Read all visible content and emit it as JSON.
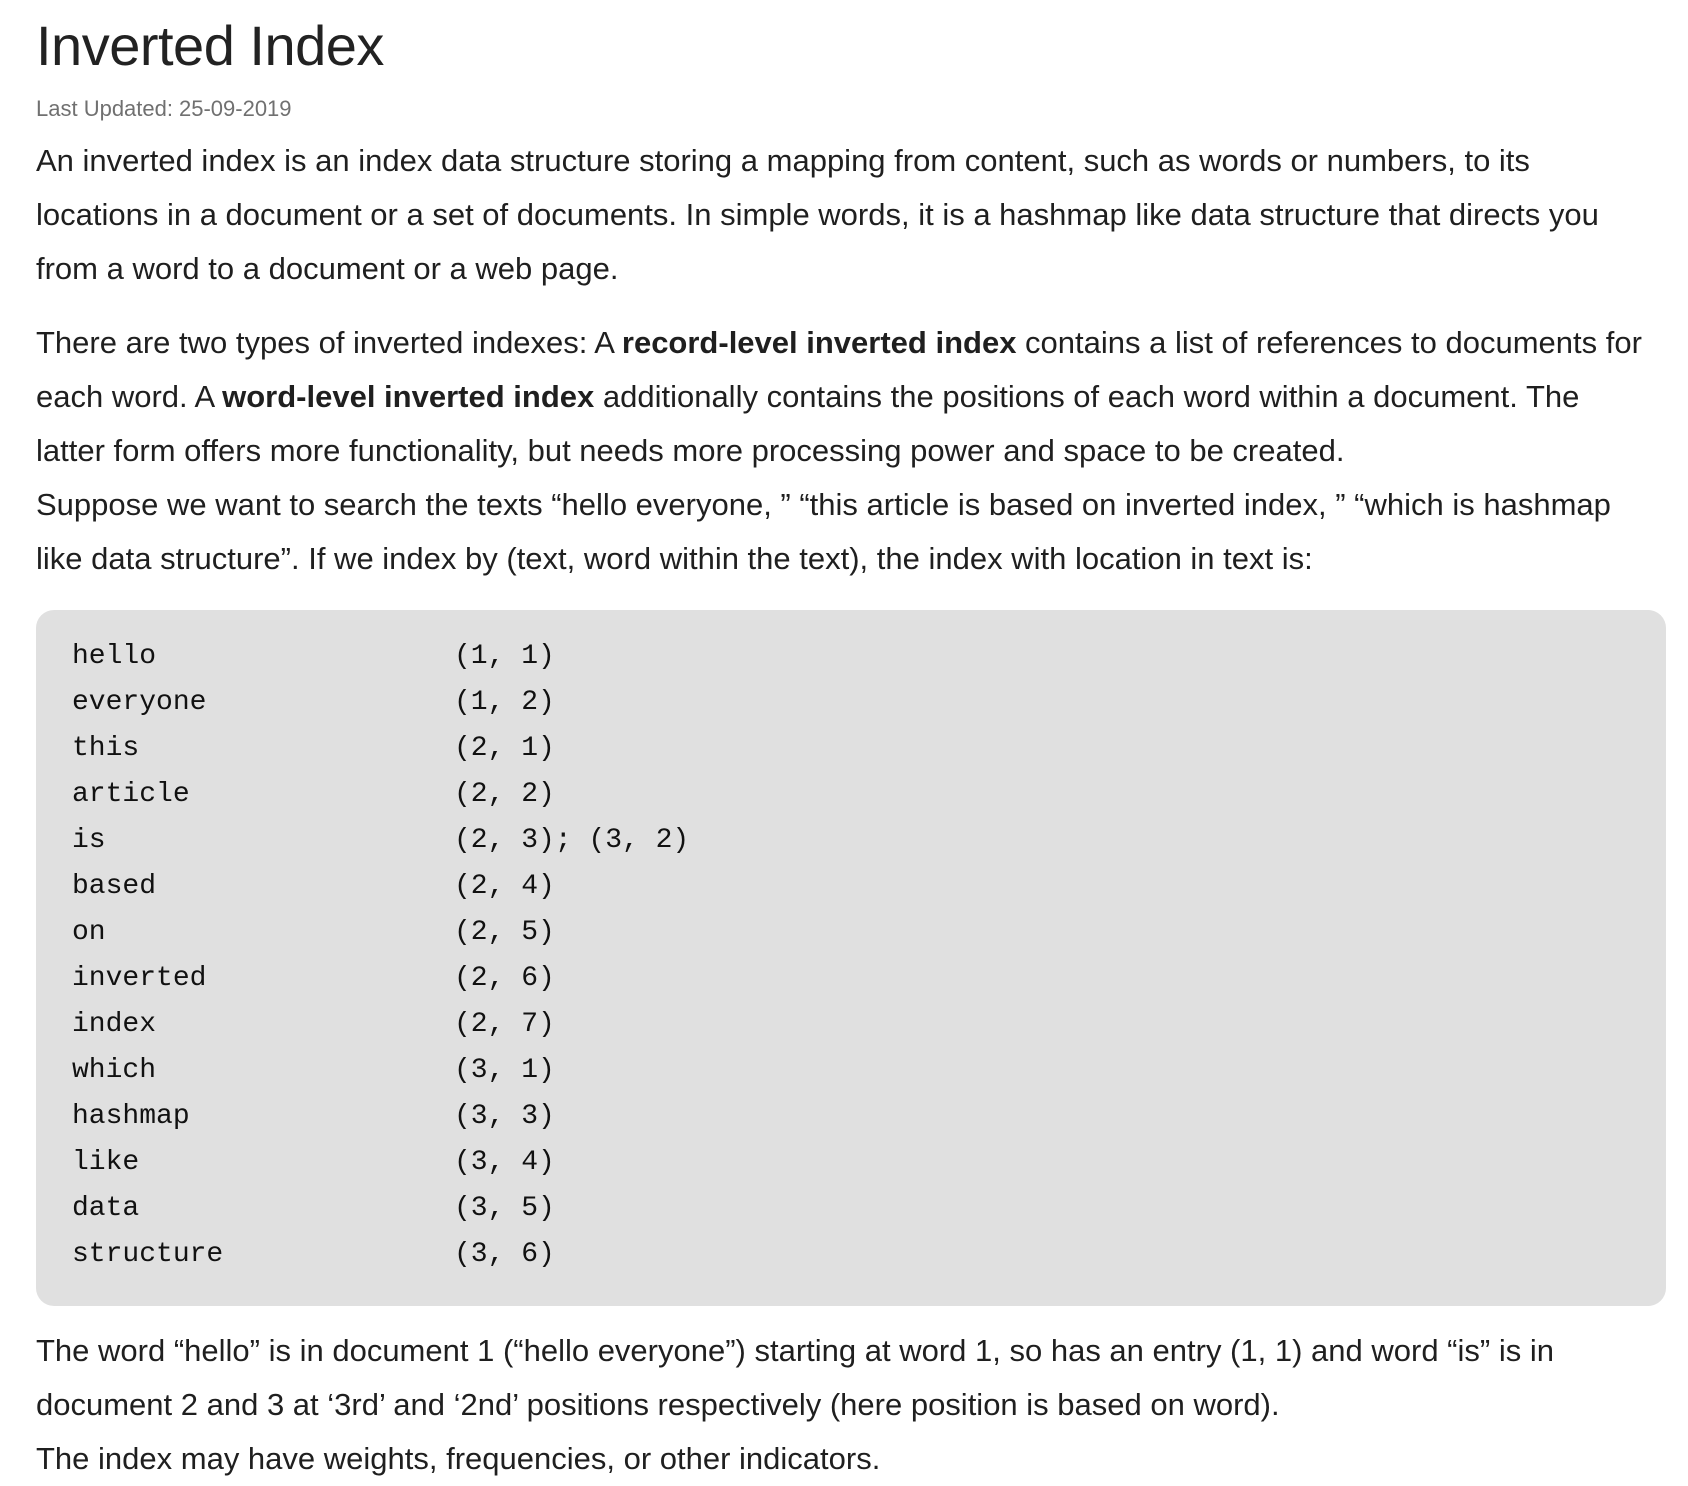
{
  "article": {
    "title": "Inverted Index",
    "last_updated_label": "Last Updated:",
    "last_updated_date": "25-09-2019",
    "p1": "An inverted index is an index data structure storing a mapping from content, such as words or numbers, to its locations in a document or a set of documents. In simple words, it is a hashmap like data structure that directs you from a word to a document or a web page.",
    "p2": {
      "t1": "There are two types of inverted indexes: A ",
      "b1": "record-level inverted index",
      "t2": " contains a list of references to documents for each word. A ",
      "b2": "word-level inverted index",
      "t3": " additionally contains the positions of each word within a document. The latter form offers more functionality, but needs more processing power and space to be created."
    },
    "p3": "Suppose we want to search the texts “hello everyone, ” “this article is based on inverted index, ” “which is hashmap like data structure”. If we index by (text, word within the text), the index with location in text is:",
    "index_rows": [
      {
        "word": "hello",
        "pos": "(1, 1)"
      },
      {
        "word": "everyone",
        "pos": "(1, 2)"
      },
      {
        "word": "this",
        "pos": "(2, 1)"
      },
      {
        "word": "article",
        "pos": "(2, 2)"
      },
      {
        "word": "is",
        "pos": "(2, 3); (3, 2)"
      },
      {
        "word": "based",
        "pos": "(2, 4)"
      },
      {
        "word": "on",
        "pos": "(2, 5)"
      },
      {
        "word": "inverted",
        "pos": "(2, 6)"
      },
      {
        "word": "index",
        "pos": "(2, 7)"
      },
      {
        "word": "which",
        "pos": "(3, 1)"
      },
      {
        "word": "hashmap",
        "pos": "(3, 3)"
      },
      {
        "word": "like",
        "pos": "(3, 4)"
      },
      {
        "word": "data",
        "pos": "(3, 5)"
      },
      {
        "word": "structure",
        "pos": "(3, 6)"
      }
    ],
    "p4": "The word “hello” is in document 1 (“hello everyone”) starting at word 1, so has an entry (1, 1) and word “is” is in document 2 and 3 at ‘3rd’ and ‘2nd’ positions respectively (here position is based on word).",
    "p5": "The index may have weights, frequencies, or other indicators."
  },
  "colors": {
    "text": "#1f1f1f",
    "muted": "#707070",
    "code_bg": "#e0e0e0"
  }
}
